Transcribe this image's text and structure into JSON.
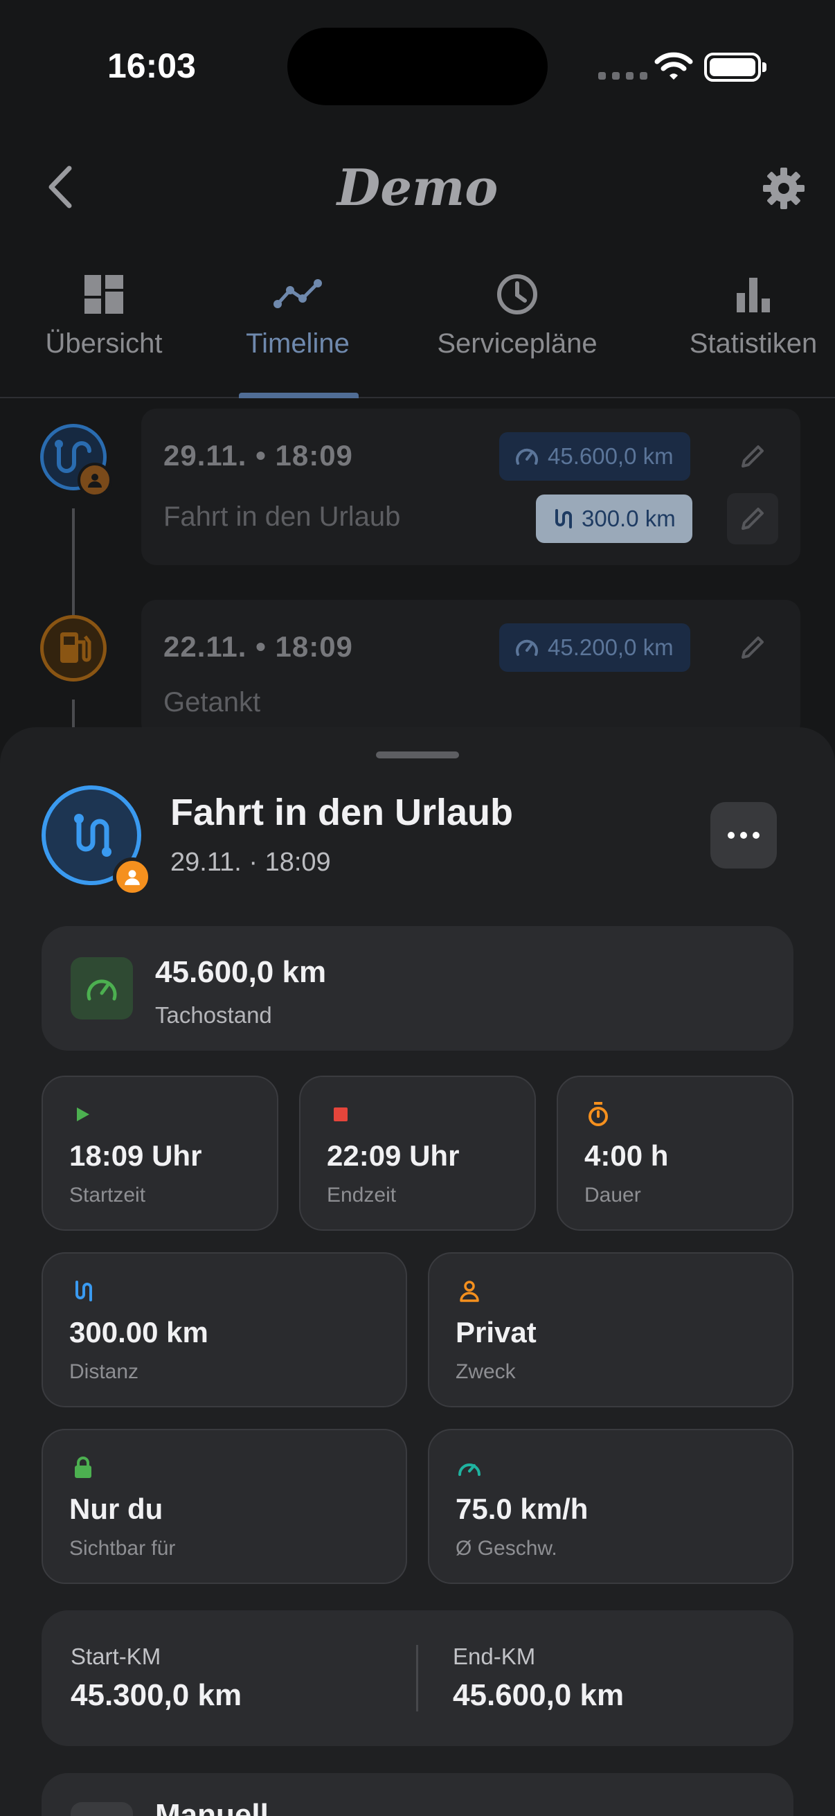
{
  "status_bar": {
    "time": "16:03"
  },
  "header": {
    "title": "Demo",
    "back_icon": "chevron-left-icon",
    "settings_icon": "gear-icon"
  },
  "tabs": [
    {
      "label": "Übersicht",
      "icon": "dashboard-icon",
      "active": false
    },
    {
      "label": "Timeline",
      "icon": "timeline-icon",
      "active": true
    },
    {
      "label": "Servicepläne",
      "icon": "clock-icon",
      "active": false
    },
    {
      "label": "Statistiken",
      "icon": "bar-chart-icon",
      "active": false
    }
  ],
  "timeline": [
    {
      "date": "29.11. • 18:09",
      "title": "Fahrt in den Urlaub",
      "odometer": "45.600,0 km",
      "distance": "300.0 km",
      "type": "trip"
    },
    {
      "date": "22.11. • 18:09",
      "title": "Getankt",
      "odometer": "45.200,0 km",
      "type": "fuel"
    }
  ],
  "detail": {
    "title": "Fahrt in den Urlaub",
    "subtitle": "29.11. · 18:09",
    "odometer": {
      "value": "45.600,0 km",
      "label": "Tachostand"
    },
    "start": {
      "value": "18:09 Uhr",
      "label": "Startzeit"
    },
    "end": {
      "value": "22:09 Uhr",
      "label": "Endzeit"
    },
    "duration": {
      "value": "4:00 h",
      "label": "Dauer"
    },
    "distance": {
      "value": "300.00 km",
      "label": "Distanz"
    },
    "purpose": {
      "value": "Privat",
      "label": "Zweck"
    },
    "visibility": {
      "value": "Nur du",
      "label": "Sichtbar für"
    },
    "speed": {
      "value": "75.0 km/h",
      "label": "Ø Geschw."
    },
    "start_km": {
      "label": "Start-KM",
      "value": "45.300,0 km"
    },
    "end_km": {
      "label": "End-KM",
      "value": "45.600,0 km"
    },
    "source": {
      "title": "Manuell"
    }
  },
  "colors": {
    "accent_blue": "#3a9af0",
    "accent_orange": "#f5901e",
    "accent_green": "#4cb050",
    "accent_red": "#e5453b",
    "accent_teal": "#1fb3a0"
  }
}
